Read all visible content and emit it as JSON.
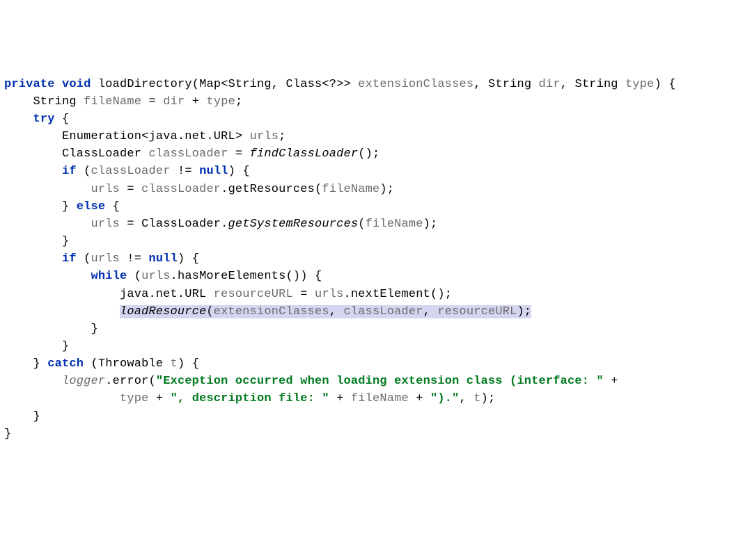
{
  "code": {
    "sig": {
      "private": "private",
      "void": "void",
      "name": "loadDirectory",
      "p1t": "Map<String, Class<?>>",
      "p1n": "extensionClasses",
      "p2t": "String",
      "p2n": "dir",
      "p3t": "String",
      "p3n": "type",
      "close": ") {"
    },
    "l2": {
      "a": "String ",
      "b": "fileName",
      "c": " = ",
      "d": "dir",
      "e": " + ",
      "f": "type",
      "g": ";"
    },
    "l3": {
      "try": "try",
      "b": " {"
    },
    "l4": {
      "a": "Enumeration<java.net.URL> ",
      "b": "urls",
      "c": ";"
    },
    "l5": {
      "a": "ClassLoader ",
      "b": "classLoader",
      "c": " = ",
      "d": "findClassLoader",
      "e": "();"
    },
    "l6": {
      "if": "if",
      "a": " (",
      "b": "classLoader",
      "c": " != ",
      "null": "null",
      "d": ") {"
    },
    "l7": {
      "a": "urls",
      "b": " = ",
      "c": "classLoader",
      "d": ".",
      "e": "getResources",
      "f": "(",
      "g": "fileName",
      "h": ");"
    },
    "l8": {
      "a": "} ",
      "else": "else",
      "b": " {"
    },
    "l9": {
      "a": "urls",
      "b": " = ClassLoader.",
      "c": "getSystemResources",
      "d": "(",
      "e": "fileName",
      "f": ");"
    },
    "l10": {
      "a": "}"
    },
    "l11": {
      "if": "if",
      "a": " (",
      "b": "urls",
      "c": " != ",
      "null": "null",
      "d": ") {"
    },
    "l12": {
      "while": "while",
      "a": " (",
      "b": "urls",
      "c": ".hasMoreElements()) {"
    },
    "l13": {
      "a": "java.net.URL ",
      "b": "resourceURL",
      "c": " = ",
      "d": "urls",
      "e": ".nextElement();"
    },
    "l14": {
      "a": "loadResource",
      "b": "(",
      "c": "extensionClasses",
      "d": ", ",
      "e": "classLoader",
      "f": ", ",
      "g": "resourceURL",
      "h": ");"
    },
    "l15": {
      "a": "}"
    },
    "l16": {
      "a": "}"
    },
    "l17": {
      "a": "} ",
      "catch": "catch",
      "b": " (Throwable ",
      "c": "t",
      "d": ") {"
    },
    "l18": {
      "a": "logger",
      "b": ".error(",
      "s1": "\"Exception occurred when loading extension class (interface: \"",
      "c": " +"
    },
    "l19": {
      "a": "type",
      "b": " + ",
      "s2": "\", description file: \"",
      "c": " + ",
      "d": "fileName",
      "e": " + ",
      "s3": "\").\"",
      "f": ", ",
      "g": "t",
      "h": ");"
    },
    "l20": {
      "a": "}"
    },
    "l21": {
      "a": "}"
    }
  }
}
